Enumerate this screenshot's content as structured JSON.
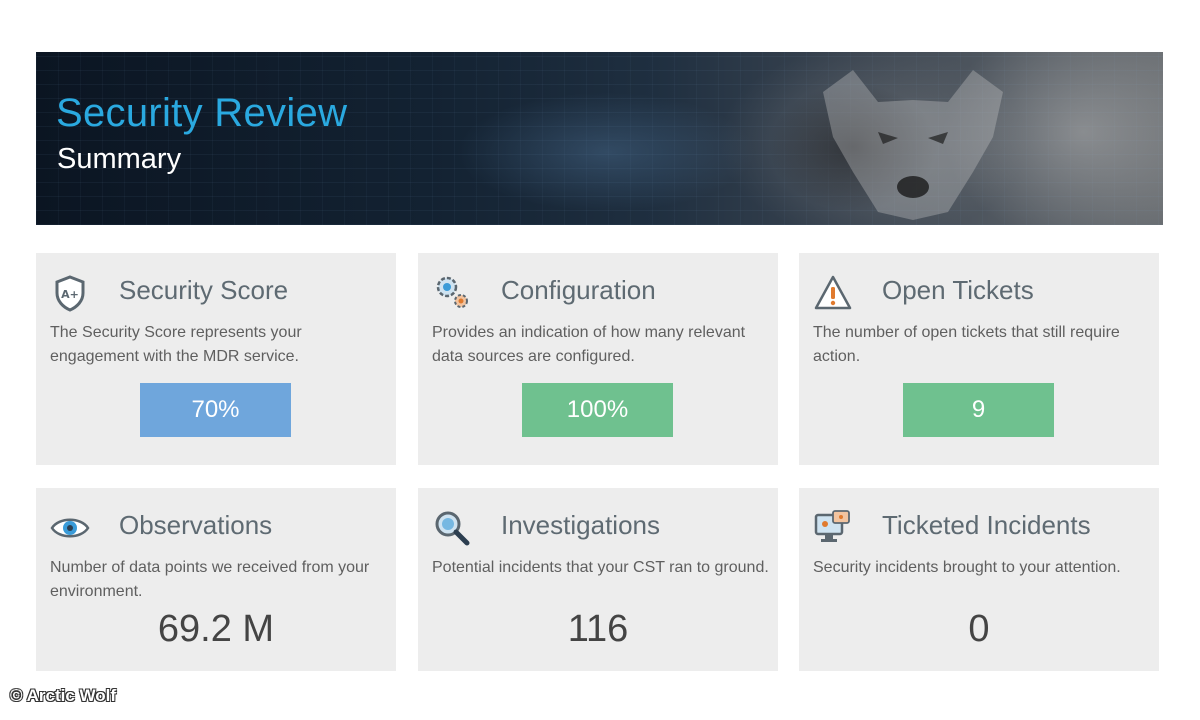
{
  "header": {
    "title": "Security Review",
    "subtitle": "Summary"
  },
  "cards": [
    {
      "title": "Security Score",
      "description": "The Security Score represents your engagement with the MDR service.",
      "value": "70%",
      "value_color": "#6fa6dc",
      "icon": "shield-icon"
    },
    {
      "title": "Configuration",
      "description": "Provides an indication of how many relevant data sources are configured.",
      "value": "100%",
      "value_color": "#6fc18f",
      "icon": "gear-icon"
    },
    {
      "title": "Open Tickets",
      "description": "The number of open tickets that still require action.",
      "value": "9",
      "value_color": "#6fc18f",
      "icon": "warning-icon"
    },
    {
      "title": "Observations",
      "description": "Number of data points we received from your environment.",
      "value": "69.2 M",
      "icon": "eye-icon"
    },
    {
      "title": "Investigations",
      "description": "Potential incidents that your CST ran to ground.",
      "value": "116",
      "icon": "magnifier-icon"
    },
    {
      "title": "Ticketed Incidents",
      "description": "Security incidents brought to your attention.",
      "value": "0",
      "icon": "monitor-alert-icon"
    }
  ],
  "footer": {
    "copyright": "© Arctic Wolf"
  },
  "colors": {
    "accent_title": "#2aa9e0",
    "card_bg": "#ededed"
  }
}
